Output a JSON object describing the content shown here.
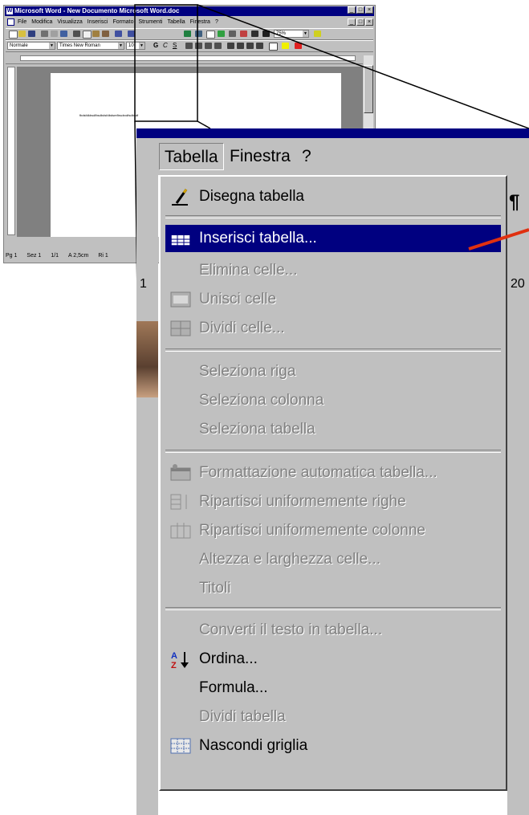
{
  "word_window": {
    "title": "Microsoft Word - New Documento Microsoft Word.doc",
    "icon_letter": "W",
    "window_controls": [
      "_",
      "□",
      "×"
    ],
    "menu": [
      "File",
      "Modifica",
      "Visualizza",
      "Inserisci",
      "Formato",
      "Strumenti",
      "Tabella",
      "Finestra",
      "?"
    ],
    "style_value": "Normale",
    "font_value": "Times New Roman",
    "size_value": "10",
    "zoom_value": "75%",
    "format_buttons": [
      "G",
      "C",
      "S"
    ],
    "document_text": "fbdsfdkbsdfbsdbdsfdbdsmfbscbxdfsdbsdf",
    "status": [
      "Pg 1",
      "Sez 1",
      "1/1",
      "A 2,5cm",
      "Ri 1"
    ]
  },
  "menubar": {
    "tabella": "Tabella",
    "finestra": "Finestra",
    "help": "?"
  },
  "side_glyphs": {
    "right_pilcrow": "¶",
    "right_number": "20",
    "left_number": "1"
  },
  "menu_items": [
    {
      "label": "Disegna tabella",
      "icon": "pencil-icon",
      "enabled": true
    },
    {
      "label": "Inserisci tabella...",
      "icon": "table-grid-icon",
      "enabled": true,
      "highlighted": true
    },
    {
      "label": "Elimina celle...",
      "enabled": false
    },
    {
      "label": "Unisci celle",
      "icon": "merge-cells-icon",
      "enabled": false
    },
    {
      "label": "Dividi celle...",
      "icon": "split-cells-icon",
      "enabled": false
    },
    {
      "label": "Seleziona riga",
      "enabled": false
    },
    {
      "label": "Seleziona colonna",
      "enabled": false
    },
    {
      "label": "Seleziona tabella",
      "enabled": false
    },
    {
      "label": "Formattazione automatica tabella...",
      "icon": "autoformat-icon",
      "enabled": false
    },
    {
      "label": "Ripartisci uniformemente righe",
      "icon": "distribute-rows-icon",
      "enabled": false
    },
    {
      "label": "Ripartisci uniformemente colonne",
      "icon": "distribute-columns-icon",
      "enabled": false
    },
    {
      "label": "Altezza e larghezza celle...",
      "enabled": false
    },
    {
      "label": "Titoli",
      "enabled": false
    },
    {
      "label": "Converti il testo in tabella...",
      "enabled": false
    },
    {
      "label": "Ordina...",
      "icon": "sort-az-icon",
      "enabled": true
    },
    {
      "label": "Formula...",
      "enabled": true
    },
    {
      "label": "Dividi tabella",
      "enabled": false
    },
    {
      "label": "Nascondi griglia",
      "icon": "gridlines-icon",
      "enabled": true
    }
  ],
  "colors": {
    "highlight": "#000080",
    "menu_face": "#c0c0c0",
    "disabled_text": "#808080",
    "arrow": "#e03010"
  }
}
